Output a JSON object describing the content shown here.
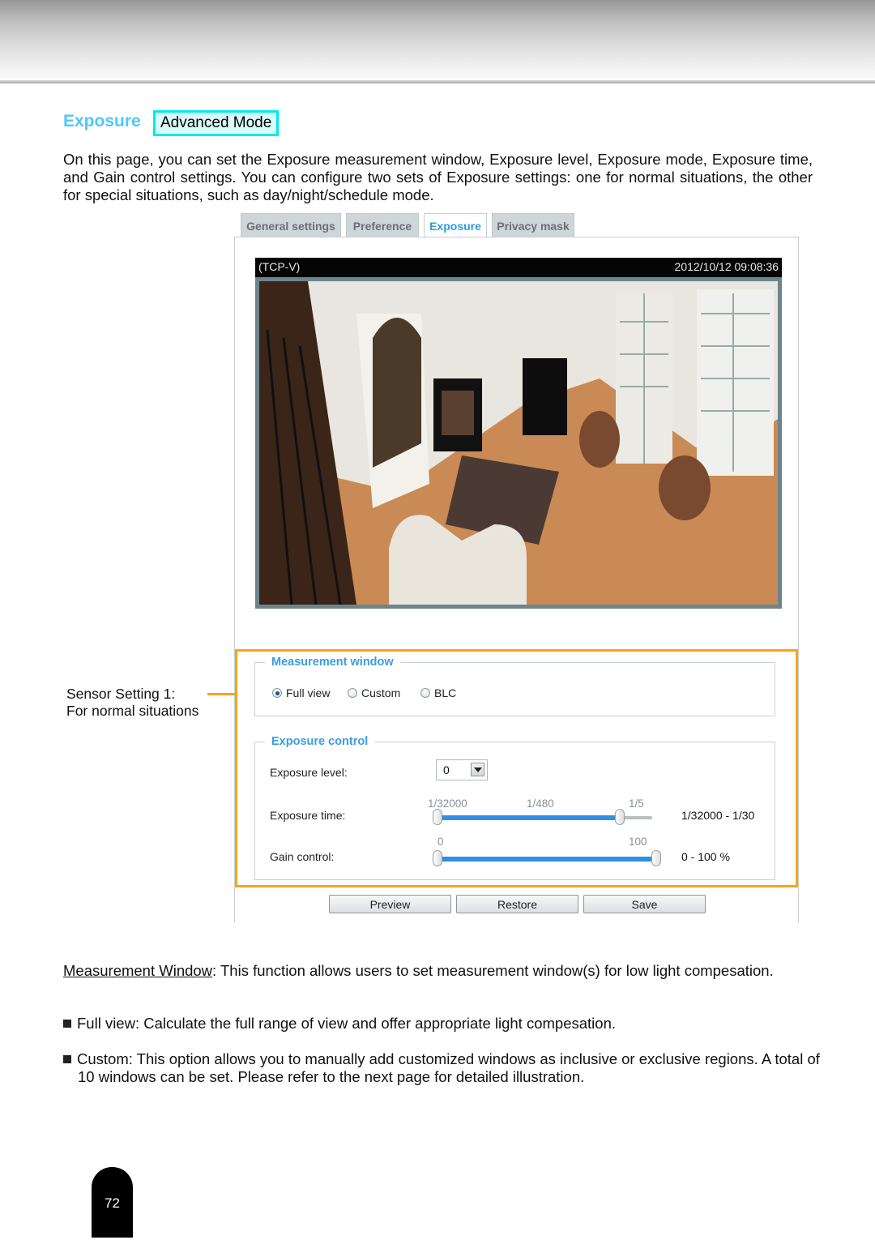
{
  "section": {
    "title": "Exposure",
    "mode_badge": "Advanced Mode",
    "intro": "On this page, you can set the Exposure measurement window, Exposure level, Exposure mode, Exposure time, and Gain control settings. You can configure two sets of Exposure settings: one for normal situations, the other for special situations, such as day/night/schedule mode."
  },
  "tabs": [
    {
      "label": "General settings",
      "active": false
    },
    {
      "label": "Preference",
      "active": false
    },
    {
      "label": "Exposure",
      "active": true
    },
    {
      "label": "Privacy mask",
      "active": false
    }
  ],
  "camera": {
    "name": "(TCP-V)",
    "timestamp": "2012/10/12 09:08:36",
    "view_icon": "live-camera-view"
  },
  "callout": {
    "line1": "Sensor Setting 1:",
    "line2": "For normal situations"
  },
  "measurement_window": {
    "legend": "Measurement window",
    "options": [
      {
        "label": "Full view",
        "checked": true
      },
      {
        "label": "Custom",
        "checked": false
      },
      {
        "label": "BLC",
        "checked": false
      }
    ]
  },
  "exposure_control": {
    "legend": "Exposure control",
    "exposure_level": {
      "label": "Exposure level:",
      "value": "0"
    },
    "exposure_time": {
      "label": "Exposure time:",
      "ticks": [
        "1/32000",
        "1/480",
        "1/5"
      ],
      "range_text": "1/32000 - 1/30",
      "min_fraction": 0.0,
      "max_fraction": 0.85
    },
    "gain_control": {
      "label": "Gain control:",
      "ticks": [
        "0",
        "100"
      ],
      "range_text": "0 - 100 %",
      "min_percent": 0,
      "max_percent": 100
    }
  },
  "buttons": {
    "preview": "Preview",
    "restore": "Restore",
    "save": "Save"
  },
  "description": {
    "mw_term": "Measurement Window",
    "mw_text": ": This function allows users to set measurement window(s) for low light compesation.",
    "bullets": [
      "Full view: Calculate the full range of view and offer appropriate light compesation.",
      "Custom: This option allows you to manually add customized windows as inclusive or exclusive regions. A total of 10 windows can be set. Please refer to the next page for detailed illustration."
    ]
  },
  "page_number": "72",
  "colors": {
    "title_accent": "#4fc9f2",
    "badge_border": "#00e8f0",
    "highlight_frame": "#f7a41b",
    "slider_fill": "#2f8fe0",
    "legend_text": "#3a9ee0"
  }
}
